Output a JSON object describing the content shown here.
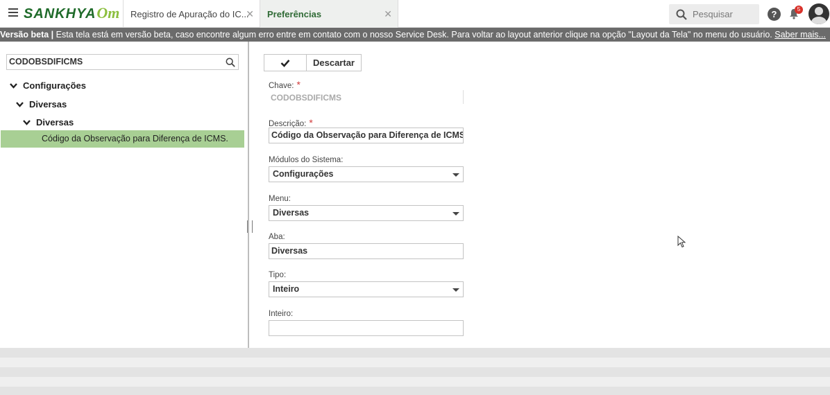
{
  "header": {
    "logo_main": "SANKHYA",
    "logo_suffix": "Om",
    "tabs": [
      {
        "label": "Registro de Apuração do IC...",
        "active": false
      },
      {
        "label": "Preferências",
        "active": true
      }
    ],
    "search_placeholder": "Pesquisar",
    "help_label": "?",
    "notification_count": "5"
  },
  "banner": {
    "title": "Versão beta |",
    "text": " Esta tela está em versão beta, caso encontre algum erro entre em contato com o nosso Service Desk. Para voltar ao layout anterior clique na opção \"Layout da Tela\" no menu do usuário. ",
    "link": "Saber mais..."
  },
  "tree": {
    "search_value": "CODOBSDIFICMS",
    "nodes": [
      {
        "label": "Configurações"
      },
      {
        "label": "Diversas"
      },
      {
        "label": "Diversas"
      }
    ],
    "selected_leaf": "Código da Observação para Diferença de ICMS."
  },
  "form": {
    "discard_label": "Descartar",
    "chave_label": "Chave:",
    "chave_value": "CODOBSDIFICMS",
    "descricao_label": "Descrição:",
    "descricao_value": "Código da Observação para Diferença de ICMS.",
    "modulos_label": "Módulos do Sistema:",
    "modulos_value": "Configurações",
    "menu_label": "Menu:",
    "menu_value": "Diversas",
    "aba_label": "Aba:",
    "aba_value": "Diversas",
    "tipo_label": "Tipo:",
    "tipo_value": "Inteiro",
    "inteiro_label": "Inteiro:",
    "inteiro_value": "",
    "required_mark": "*"
  },
  "colors": {
    "accent_green": "#2f6a35",
    "selection_green": "#a8cf94",
    "banner_bg": "#6b6b6b",
    "badge_red": "#d9322b"
  }
}
